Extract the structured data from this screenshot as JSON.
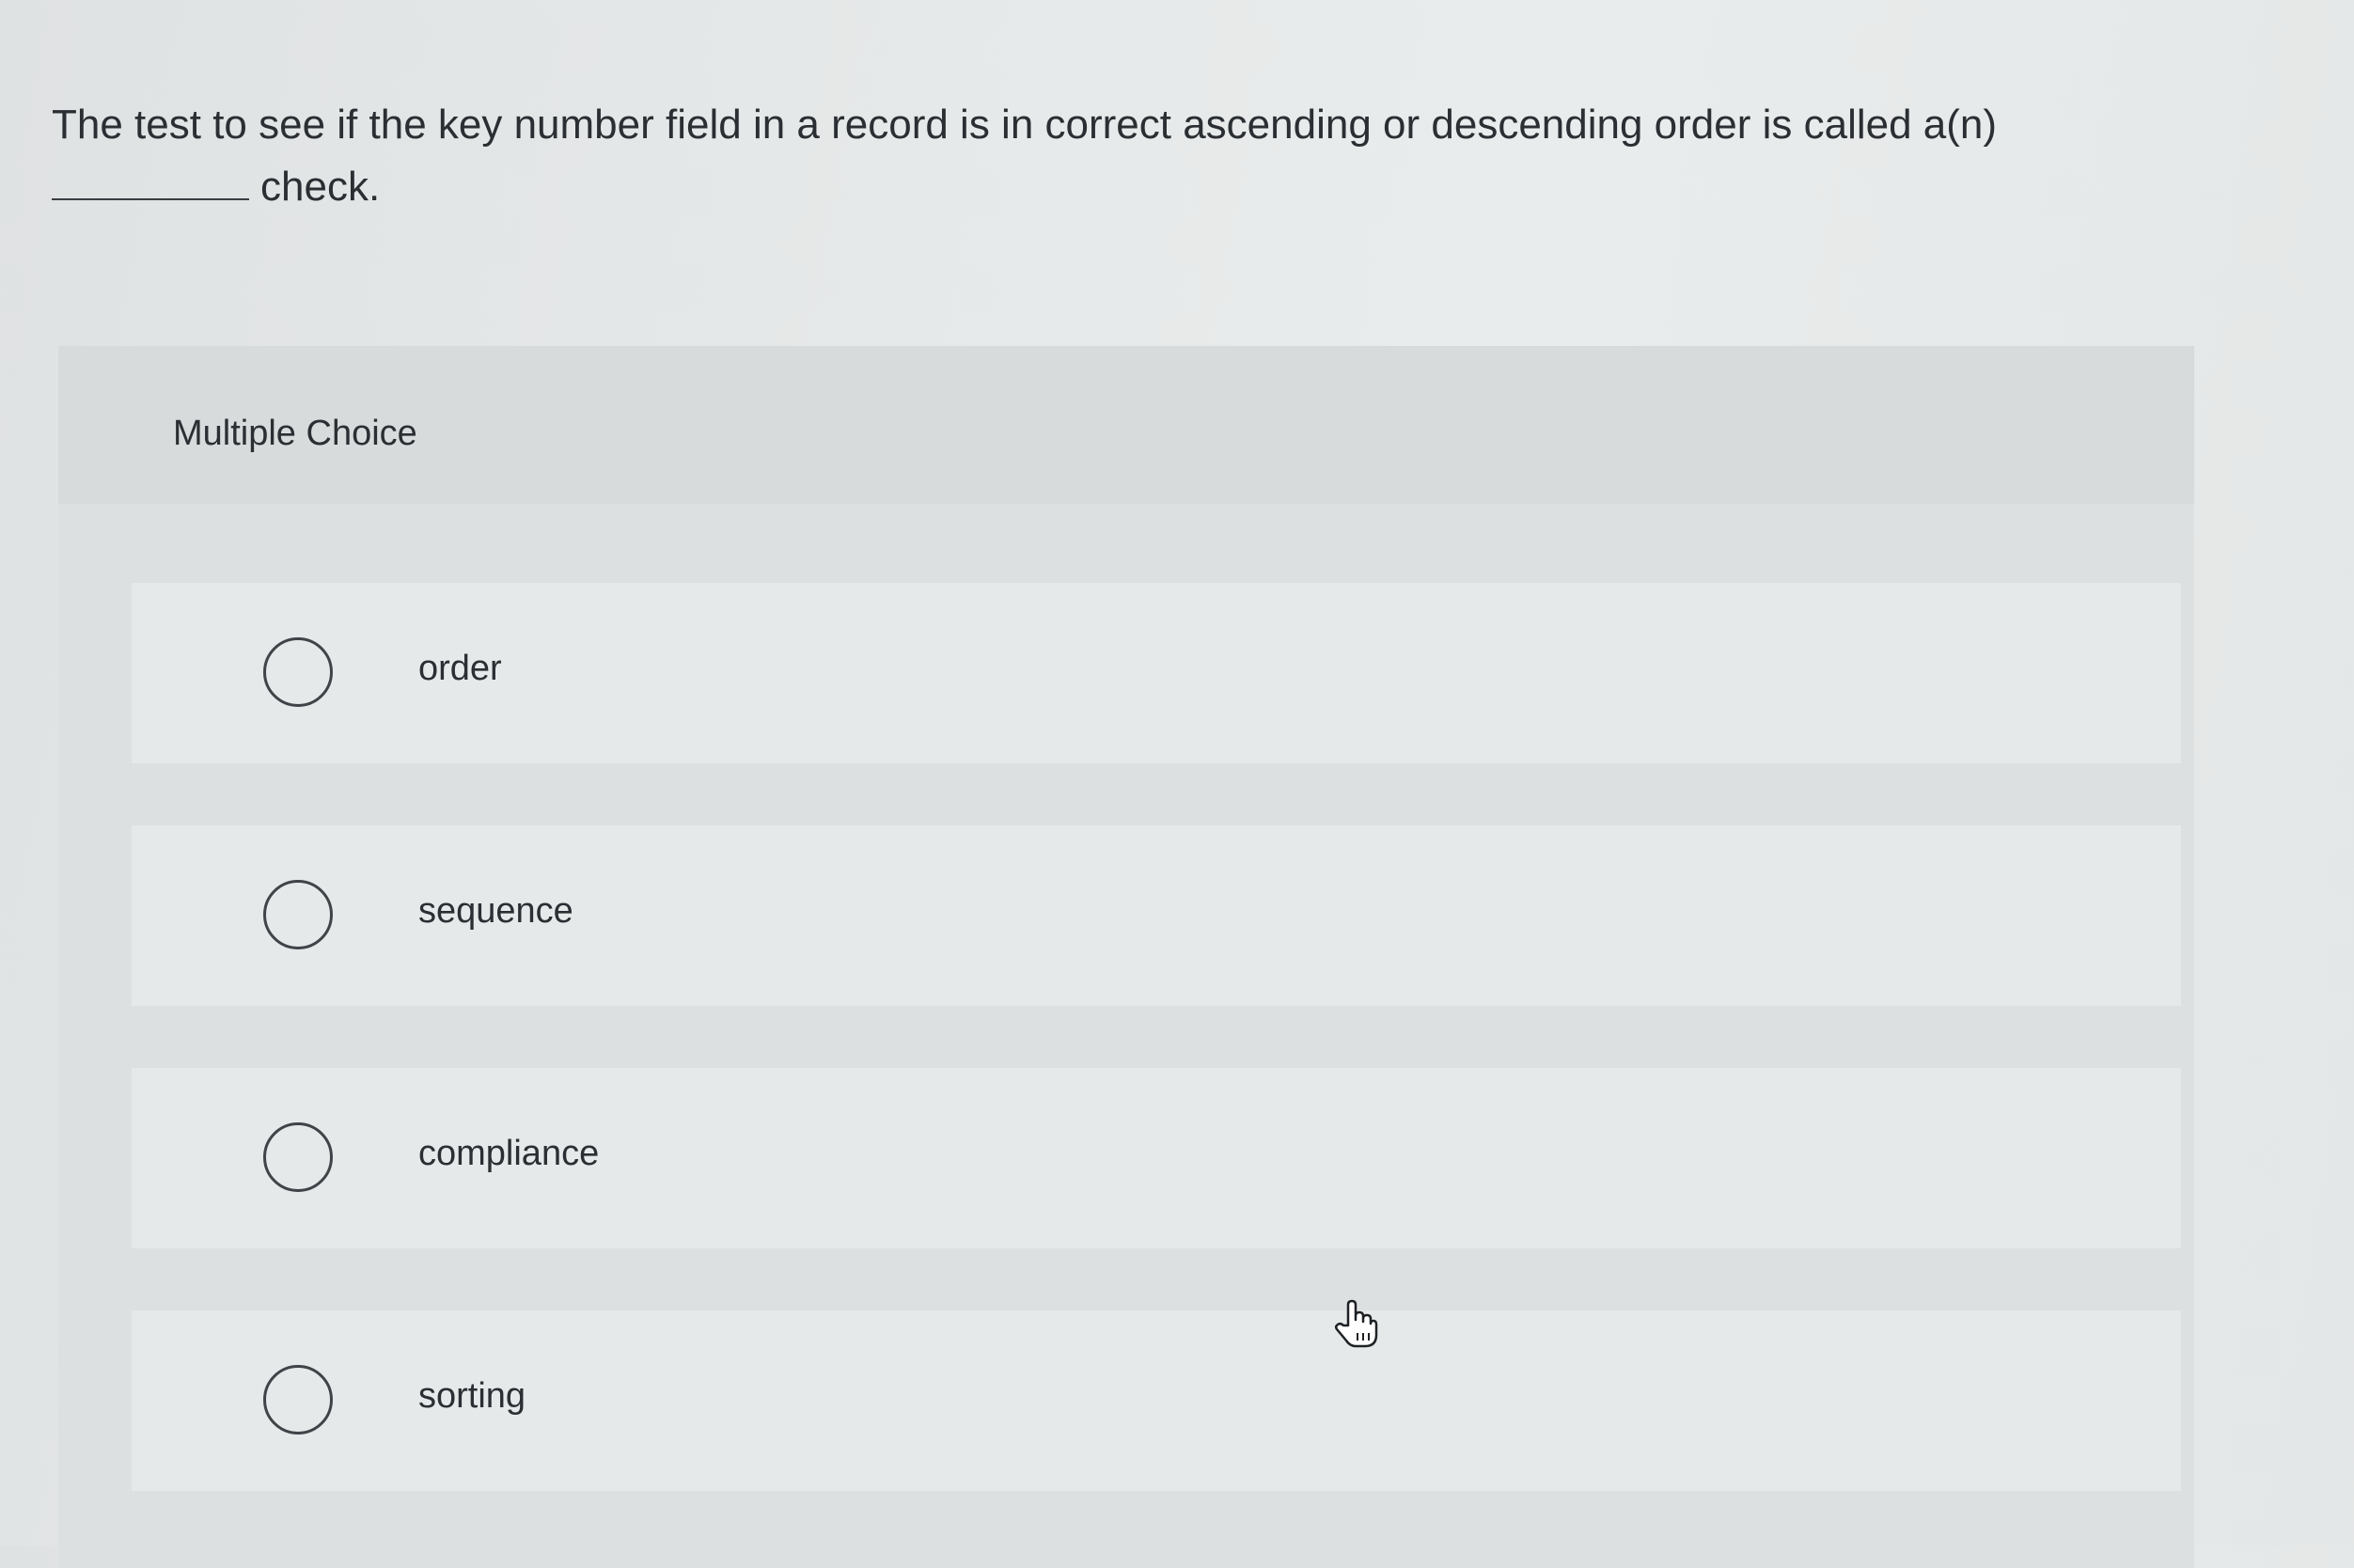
{
  "question": {
    "line1": "The test to see if the key number field in a record is in correct ascending or descending order is called a(n)",
    "line2": "check."
  },
  "panel": {
    "title": "Multiple Choice"
  },
  "options": [
    {
      "label": "order",
      "selected": false
    },
    {
      "label": "sequence",
      "selected": false
    },
    {
      "label": "compliance",
      "selected": false
    },
    {
      "label": "sorting",
      "selected": false
    }
  ],
  "cursor": {
    "icon": "hand-pointer-icon"
  }
}
